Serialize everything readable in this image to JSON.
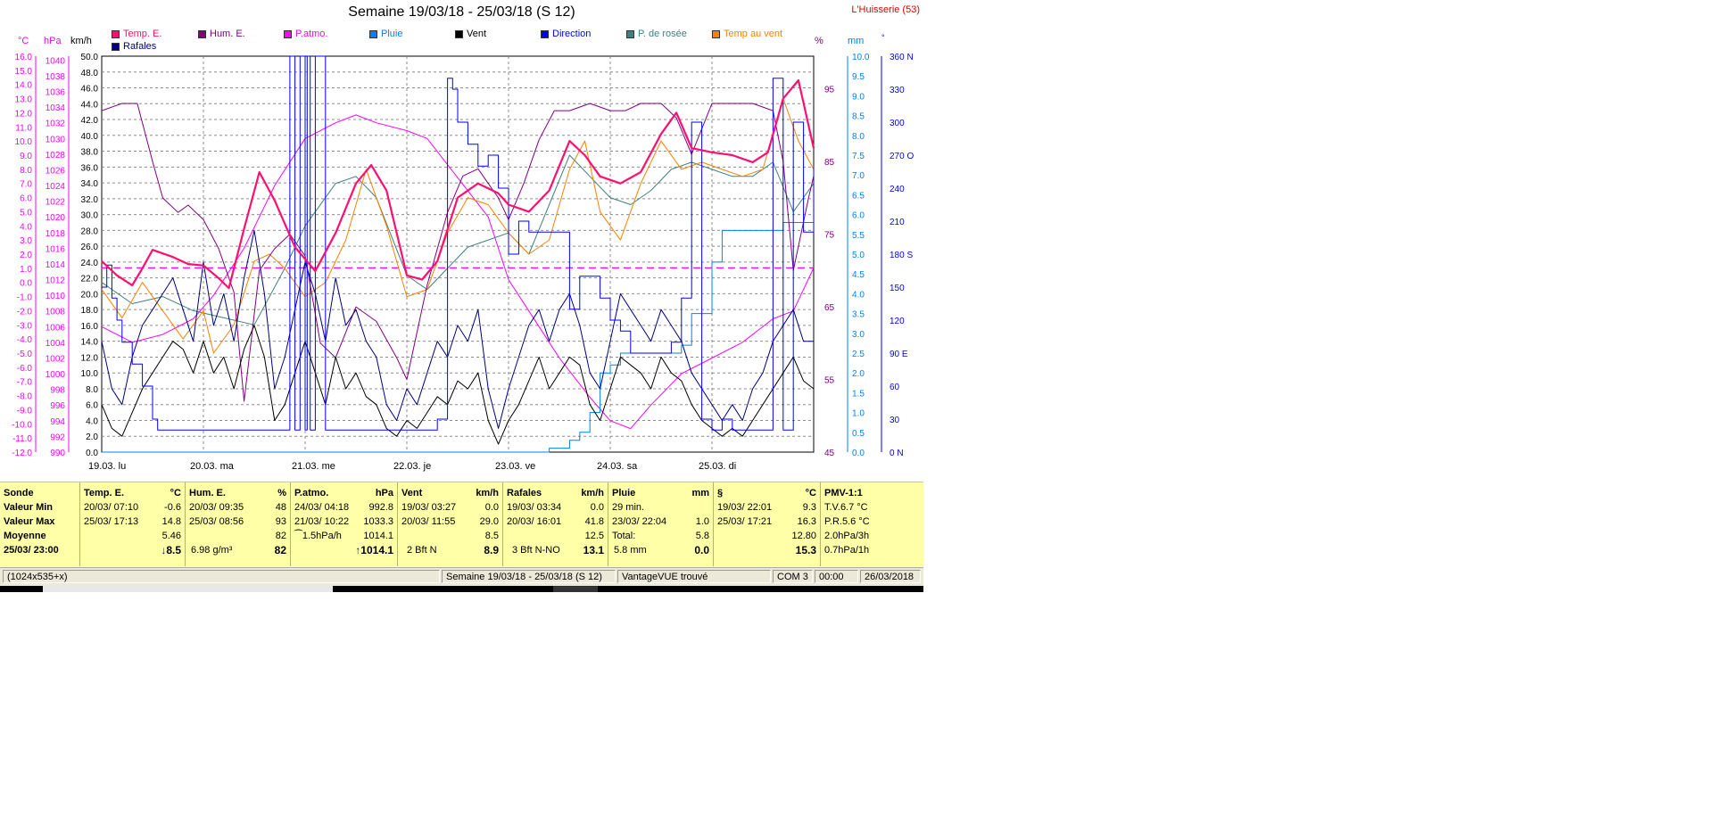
{
  "title": "Semaine 19/03/18 - 25/03/18 (S 12)",
  "station": "L'Huisserie (53)",
  "axis_units": {
    "temp": "°C",
    "press": "hPa",
    "speed": "km/h",
    "hum": "%",
    "rain": "mm",
    "dir": "°"
  },
  "legend": [
    {
      "label": "Temp. E.",
      "color": "#ff1070"
    },
    {
      "label": "Hum. E.",
      "color": "#800080"
    },
    {
      "label": "P.atmo.",
      "color": "#ff00ff"
    },
    {
      "label": "Pluie",
      "color": "#0080ff"
    },
    {
      "label": "Vent",
      "color": "#000000"
    },
    {
      "label": "Direction",
      "color": "#0000ff"
    },
    {
      "label": "P. de rosée",
      "color": "#408080"
    },
    {
      "label": "Temp au vent",
      "color": "#ff8000"
    },
    {
      "label": "Rafales",
      "color": "#000080"
    }
  ],
  "axes": {
    "temp_ticks": [
      "16.0",
      "15.0",
      "14.0",
      "13.0",
      "12.0",
      "11.0",
      "10.0",
      "9.0",
      "8.0",
      "7.0",
      "6.0",
      "5.0",
      "4.0",
      "3.0",
      "2.0",
      "1.0",
      "0.0",
      "-1.0",
      "-2.0",
      "-3.0",
      "-4.0",
      "-5.0",
      "-6.0",
      "-7.0",
      "-8.0",
      "-9.0",
      "-10.0",
      "-11.0",
      "-12.0"
    ],
    "press_ticks": [
      "1040",
      "1038",
      "1036",
      "1034",
      "1032",
      "1030",
      "1028",
      "1026",
      "1024",
      "1022",
      "1020",
      "1018",
      "1016",
      "1014",
      "1012",
      "1010",
      "1008",
      "1006",
      "1004",
      "1002",
      "1000",
      "998",
      "996",
      "994",
      "992",
      "990"
    ],
    "speed_ticks": [
      "50.0",
      "48.0",
      "46.0",
      "44.0",
      "42.0",
      "40.0",
      "38.0",
      "36.0",
      "34.0",
      "32.0",
      "30.0",
      "28.0",
      "26.0",
      "24.0",
      "22.0",
      "20.0",
      "18.0",
      "16.0",
      "14.0",
      "12.0",
      "10.0",
      "8.0",
      "6.0",
      "4.0",
      "2.0",
      "0.0"
    ],
    "hum_ticks": [
      "95",
      "85",
      "75",
      "65",
      "55",
      "45"
    ],
    "rain_ticks": [
      "10.0",
      "9.5",
      "9.0",
      "8.5",
      "8.0",
      "7.5",
      "7.0",
      "6.5",
      "6.0",
      "5.5",
      "5.0",
      "4.5",
      "4.0",
      "3.5",
      "3.0",
      "2.5",
      "2.0",
      "1.5",
      "1.0",
      "0.5",
      "0.0"
    ],
    "dir_ticks": [
      "360 N",
      "330",
      "300",
      "270 O",
      "240",
      "210",
      "180 S",
      "150",
      "120",
      "90  E",
      "60",
      "30",
      "0   N"
    ],
    "days": [
      "19.03.  lu",
      "20.03.  ma",
      "21.03.  me",
      "22.03.  je",
      "23.03.  ve",
      "24.03.  sa",
      "25.03.  di"
    ]
  },
  "chart_data": {
    "type": "line",
    "x_unit": "day",
    "x_range": [
      0,
      7
    ],
    "series": [
      {
        "name": "Temp. E.",
        "color": "#ff1070",
        "axis": "temp",
        "width": 2.2,
        "x": [
          0,
          0.15,
          0.3,
          0.4,
          0.5,
          0.7,
          0.85,
          1.0,
          1.15,
          1.25,
          1.4,
          1.55,
          1.7,
          1.9,
          2.1,
          2.3,
          2.5,
          2.65,
          2.8,
          3.0,
          3.15,
          3.3,
          3.5,
          3.7,
          3.9,
          4.0,
          4.2,
          4.4,
          4.6,
          4.75,
          4.9,
          5.1,
          5.3,
          5.5,
          5.65,
          5.8,
          6.0,
          6.2,
          6.4,
          6.55,
          6.7,
          6.85,
          7.0
        ],
        "y": [
          1.5,
          0.5,
          -0.2,
          1.0,
          2.3,
          1.8,
          1.3,
          1.2,
          0.3,
          -0.4,
          3.8,
          7.8,
          5.8,
          2.5,
          0.8,
          3.5,
          7.0,
          8.3,
          6.5,
          0.5,
          0.2,
          1.5,
          6.0,
          7.0,
          6.3,
          5.5,
          5.0,
          6.5,
          10.0,
          9.0,
          7.5,
          7.0,
          7.8,
          10.5,
          12.0,
          9.5,
          9.2,
          9.0,
          8.5,
          9.2,
          13.0,
          14.3,
          9.5
        ]
      },
      {
        "name": "Hum. E.",
        "color": "#800080",
        "axis": "hum",
        "x": [
          0,
          0.2,
          0.35,
          0.5,
          0.6,
          0.75,
          0.85,
          1.0,
          1.15,
          1.3,
          1.4,
          1.55,
          1.7,
          1.85,
          2.0,
          2.15,
          2.3,
          2.5,
          2.7,
          2.9,
          3.0,
          3.2,
          3.4,
          3.55,
          3.7,
          3.9,
          4.0,
          4.15,
          4.3,
          4.45,
          4.6,
          4.8,
          5.0,
          5.15,
          5.3,
          5.5,
          5.65,
          5.8,
          6.0,
          6.2,
          6.4,
          6.6,
          6.7,
          6.8,
          6.95,
          7.0
        ],
        "y": [
          92,
          93,
          93,
          85,
          80,
          78,
          79,
          77,
          73,
          67,
          52,
          70,
          73,
          75,
          72,
          60,
          58,
          65,
          63,
          58,
          55,
          68,
          78,
          83,
          84,
          80,
          77,
          82,
          88,
          92,
          92,
          93,
          92,
          92,
          93,
          93,
          91,
          86,
          93,
          93,
          93,
          92,
          85,
          70,
          80,
          83
        ]
      },
      {
        "name": "P.atmo.",
        "color": "#ff00ff",
        "axis": "press",
        "x": [
          0,
          0.3,
          0.6,
          0.9,
          1.1,
          1.4,
          1.7,
          2.0,
          2.3,
          2.5,
          2.7,
          3.0,
          3.2,
          3.5,
          3.8,
          4.0,
          4.3,
          4.5,
          4.8,
          5.0,
          5.2,
          5.4,
          5.7,
          6.0,
          6.3,
          6.6,
          6.8,
          7.0
        ],
        "y": [
          1006,
          1004,
          1005,
          1007,
          1010,
          1016,
          1024,
          1030,
          1032,
          1033,
          1032,
          1031,
          1030,
          1025,
          1020,
          1012,
          1006,
          1002,
          997,
          994,
          993,
          996,
          1000,
          1002,
          1004,
          1007,
          1008,
          1013.5
        ]
      },
      {
        "name": "P.atmo. (pointillé)",
        "color": "#ff00ff",
        "axis": "press",
        "dashed": true,
        "x": [
          0,
          7
        ],
        "y": [
          1013.5,
          1013.5
        ]
      },
      {
        "name": "P. de rosée",
        "color": "#408080",
        "axis": "temp",
        "x": [
          0,
          0.3,
          0.6,
          0.9,
          1.2,
          1.5,
          1.8,
          2.0,
          2.3,
          2.5,
          2.7,
          3.0,
          3.2,
          3.4,
          3.6,
          3.8,
          4.0,
          4.2,
          4.4,
          4.6,
          4.8,
          5.0,
          5.2,
          5.4,
          5.6,
          5.8,
          6.0,
          6.2,
          6.4,
          6.6,
          6.8,
          7.0
        ],
        "y": [
          0,
          -1.5,
          -1.0,
          -2.0,
          -2.5,
          -3.0,
          1.0,
          4.0,
          7.0,
          7.5,
          6.0,
          0.5,
          -0.5,
          1.0,
          2.5,
          3.0,
          3.5,
          2.0,
          5.5,
          9.0,
          7.5,
          6.0,
          5.5,
          6.5,
          8.0,
          8.5,
          8.0,
          7.5,
          7.5,
          8.5,
          5.0,
          7.0
        ]
      },
      {
        "name": "Temp au vent",
        "color": "#ff8000",
        "axis": "temp",
        "x": [
          0,
          0.2,
          0.4,
          0.6,
          0.8,
          1.0,
          1.1,
          1.3,
          1.5,
          1.65,
          1.8,
          2.0,
          2.2,
          2.4,
          2.6,
          2.8,
          3.0,
          3.2,
          3.4,
          3.6,
          3.8,
          4.0,
          4.2,
          4.4,
          4.6,
          4.75,
          4.9,
          5.1,
          5.3,
          5.5,
          5.7,
          5.9,
          6.1,
          6.3,
          6.5,
          6.7,
          6.85,
          7.0
        ],
        "y": [
          -0.5,
          -2.5,
          0.0,
          -2.0,
          -4.0,
          -2.0,
          -5.0,
          -3.0,
          1.5,
          2.0,
          1.0,
          -1.0,
          0.0,
          3.0,
          8.0,
          4.0,
          -1.0,
          -0.5,
          3.5,
          6.0,
          5.5,
          3.5,
          2.0,
          3.0,
          8.0,
          10.0,
          5.0,
          3.0,
          7.0,
          10.0,
          8.0,
          8.5,
          8.0,
          7.5,
          8.0,
          13.0,
          10.0,
          8.0
        ]
      },
      {
        "name": "Vent",
        "color": "#000000",
        "axis": "speed",
        "x": [
          0,
          0.1,
          0.2,
          0.3,
          0.4,
          0.5,
          0.6,
          0.7,
          0.8,
          0.9,
          1.0,
          1.1,
          1.2,
          1.3,
          1.4,
          1.5,
          1.6,
          1.7,
          1.8,
          1.9,
          2.0,
          2.1,
          2.2,
          2.3,
          2.4,
          2.5,
          2.6,
          2.7,
          2.8,
          2.9,
          3.0,
          3.1,
          3.2,
          3.3,
          3.4,
          3.5,
          3.6,
          3.7,
          3.8,
          3.9,
          4.0,
          4.1,
          4.2,
          4.3,
          4.4,
          4.5,
          4.6,
          4.7,
          4.8,
          4.9,
          5.0,
          5.1,
          5.2,
          5.3,
          5.4,
          5.5,
          5.6,
          5.7,
          5.8,
          5.9,
          6.0,
          6.1,
          6.2,
          6.3,
          6.4,
          6.5,
          6.6,
          6.7,
          6.8,
          6.9,
          7.0
        ],
        "y": [
          6,
          3,
          2,
          5,
          8,
          10,
          12,
          14,
          13,
          10,
          14,
          10,
          12,
          8,
          13,
          16,
          12,
          4,
          6,
          10,
          14,
          10,
          6,
          12,
          8,
          10,
          7,
          6,
          3,
          2,
          4,
          3,
          5,
          7,
          6,
          9,
          8,
          10,
          4,
          1,
          4,
          6,
          9,
          12,
          8,
          10,
          12,
          11,
          6,
          4,
          8,
          12,
          11,
          10,
          8,
          12,
          10,
          9,
          6,
          4,
          3,
          2,
          3,
          2,
          4,
          6,
          8,
          10,
          12,
          9,
          8
        ]
      },
      {
        "name": "Rafales",
        "color": "#000080",
        "axis": "speed",
        "x": [
          0,
          0.1,
          0.2,
          0.3,
          0.4,
          0.5,
          0.6,
          0.7,
          0.8,
          0.9,
          1.0,
          1.1,
          1.2,
          1.3,
          1.4,
          1.5,
          1.6,
          1.7,
          1.8,
          1.9,
          2.0,
          2.1,
          2.2,
          2.3,
          2.4,
          2.5,
          2.6,
          2.7,
          2.8,
          2.9,
          3.0,
          3.1,
          3.2,
          3.3,
          3.4,
          3.5,
          3.6,
          3.7,
          3.8,
          3.9,
          4.0,
          4.1,
          4.2,
          4.3,
          4.4,
          4.5,
          4.6,
          4.7,
          4.8,
          4.9,
          5.0,
          5.1,
          5.2,
          5.3,
          5.4,
          5.5,
          5.6,
          5.7,
          5.8,
          5.9,
          6.0,
          6.1,
          6.2,
          6.3,
          6.4,
          6.5,
          6.6,
          6.7,
          6.8,
          6.9,
          7.0
        ],
        "y": [
          14,
          8,
          6,
          12,
          16,
          18,
          20,
          22,
          18,
          14,
          24,
          16,
          20,
          14,
          22,
          28,
          20,
          8,
          12,
          18,
          24,
          20,
          14,
          22,
          16,
          18,
          14,
          12,
          6,
          4,
          8,
          6,
          10,
          14,
          12,
          16,
          14,
          18,
          8,
          3,
          8,
          12,
          16,
          18,
          14,
          18,
          20,
          16,
          10,
          8,
          14,
          20,
          18,
          16,
          14,
          18,
          16,
          14,
          10,
          8,
          6,
          4,
          6,
          4,
          8,
          10,
          14,
          16,
          18,
          14,
          14
        ]
      },
      {
        "name": "Pluie",
        "color": "#0080ff",
        "axis": "rain",
        "x": [
          0,
          3.95,
          4.0,
          4.3,
          4.4,
          4.6,
          4.7,
          4.8,
          4.9,
          5.0,
          5.1,
          5.3,
          5.6,
          5.7,
          5.8,
          6.0,
          6.1,
          6.3,
          6.5,
          6.7,
          6.8,
          7.0
        ],
        "y": [
          0,
          0,
          0,
          0,
          0.1,
          0.3,
          0.5,
          1.0,
          2.0,
          2.2,
          2.5,
          2.5,
          2.5,
          2.7,
          3.5,
          4.8,
          5.6,
          5.6,
          5.6,
          5.8,
          5.8,
          5.8
        ]
      },
      {
        "name": "Direction",
        "color": "#0000ff",
        "axis": "dir",
        "x": [
          0,
          0.05,
          0.1,
          0.15,
          0.2,
          0.3,
          0.4,
          0.5,
          0.55,
          0.6,
          0.7,
          0.8,
          0.9,
          1.0,
          1.2,
          1.4,
          1.6,
          1.8,
          1.85,
          1.9,
          1.95,
          2.0,
          2.02,
          2.05,
          2.1,
          2.15,
          2.2,
          2.3,
          2.4,
          2.5,
          2.6,
          2.7,
          2.8,
          2.85,
          2.9,
          3.0,
          3.1,
          3.2,
          3.3,
          3.4,
          3.45,
          3.5,
          3.6,
          3.7,
          3.8,
          3.9,
          4.0,
          4.1,
          4.2,
          4.3,
          4.4,
          4.5,
          4.6,
          4.7,
          4.8,
          4.9,
          5.0,
          5.1,
          5.2,
          5.3,
          5.4,
          5.5,
          5.6,
          5.7,
          5.8,
          5.9,
          6.0,
          6.1,
          6.2,
          6.3,
          6.4,
          6.5,
          6.6,
          6.7,
          6.8,
          6.9,
          7.0
        ],
        "y": [
          150,
          170,
          140,
          120,
          100,
          80,
          60,
          30,
          20,
          20,
          20,
          20,
          20,
          20,
          20,
          20,
          20,
          20,
          360,
          20,
          360,
          20,
          360,
          20,
          360,
          360,
          20,
          20,
          20,
          20,
          20,
          20,
          20,
          20,
          20,
          20,
          20,
          20,
          30,
          340,
          330,
          300,
          280,
          260,
          270,
          240,
          180,
          210,
          200,
          200,
          200,
          200,
          130,
          160,
          160,
          140,
          120,
          110,
          90,
          90,
          90,
          90,
          100,
          140,
          300,
          30,
          20,
          30,
          20,
          20,
          20,
          20,
          340,
          20,
          300,
          200,
          260
        ]
      }
    ]
  },
  "stats": {
    "sonde": {
      "header": "Sonde",
      "min": "Valeur Min",
      "max": "Valeur Max",
      "avg": "Moyenne",
      "cur": "25/03/ 23:00"
    },
    "temp": {
      "header": "Temp. E.",
      "unit": "°C",
      "min_time": "20/03/  07:10",
      "min_val": "-0.6",
      "max_time": "25/03/  17:13",
      "max_val": "14.8",
      "avg": "5.46",
      "cur_arrow": "↓",
      "cur": "8.5"
    },
    "hum": {
      "header": "Hum. E.",
      "unit": "%",
      "min_time": "20/03/  09:35",
      "min_val": "48",
      "max_time": "25/03/  08:56",
      "max_val": "93",
      "avg": "82",
      "extra": "6.98 g/m³",
      "cur": "82"
    },
    "press": {
      "header": "P.atmo.",
      "unit": "hPa",
      "min_time": "24/03/  04:18",
      "min_val": "992.8",
      "max_time": "21/03/  10:22",
      "max_val": "1033.3",
      "trend": "⁀1.5hPa/h",
      "avg": "1014.1",
      "cur_arrow": "↑",
      "cur": "1014.1"
    },
    "wind": {
      "header": "Vent",
      "unit": "km/h",
      "min_time": "19/03/  03:27",
      "min_val": "0.0",
      "max_time": "20/03/  11:55",
      "max_val": "29.0",
      "avg": "8.5",
      "extra": "2 Bft N",
      "cur": "8.9"
    },
    "gust": {
      "header": "Rafales",
      "unit": "km/h",
      "min_time": "19/03/  03:34",
      "min_val": "0.0",
      "max_time": "20/03/  16:01",
      "max_val": "41.8",
      "avg": "12.5",
      "extra": "3 Bft N-NO",
      "cur": "13.1"
    },
    "rain": {
      "header": "Pluie",
      "unit": "mm",
      "min_time": "29 min.",
      "max_time": "23/03/  22:04",
      "max_val": "1.0",
      "total_label": "Total:",
      "total": "5.8",
      "extra": "5.8 mm",
      "cur": "0.0"
    },
    "dewx": {
      "header": "§",
      "unit": "°C",
      "min_time": "19/03/  22:01",
      "min_val": "9.3",
      "max_time": "25/03/  17:21",
      "max_val": "16.3",
      "avg": "12.80",
      "cur": "15.3"
    },
    "pmv": {
      "header": "PMV-1:1",
      "l1": "T.V.6.7 °C",
      "l2": "P.R.5.6 °C",
      "l3": "2.0hPa/3h",
      "l4": "0.7hPa/1h"
    }
  },
  "statusbar": {
    "size": "(1024x535+x)",
    "week": "Semaine 19/03/18 - 25/03/18 (S 12)",
    "console": "VantageVUE trouvé",
    "port": "COM 3",
    "time": "00:00",
    "date": "26/03/2018"
  }
}
